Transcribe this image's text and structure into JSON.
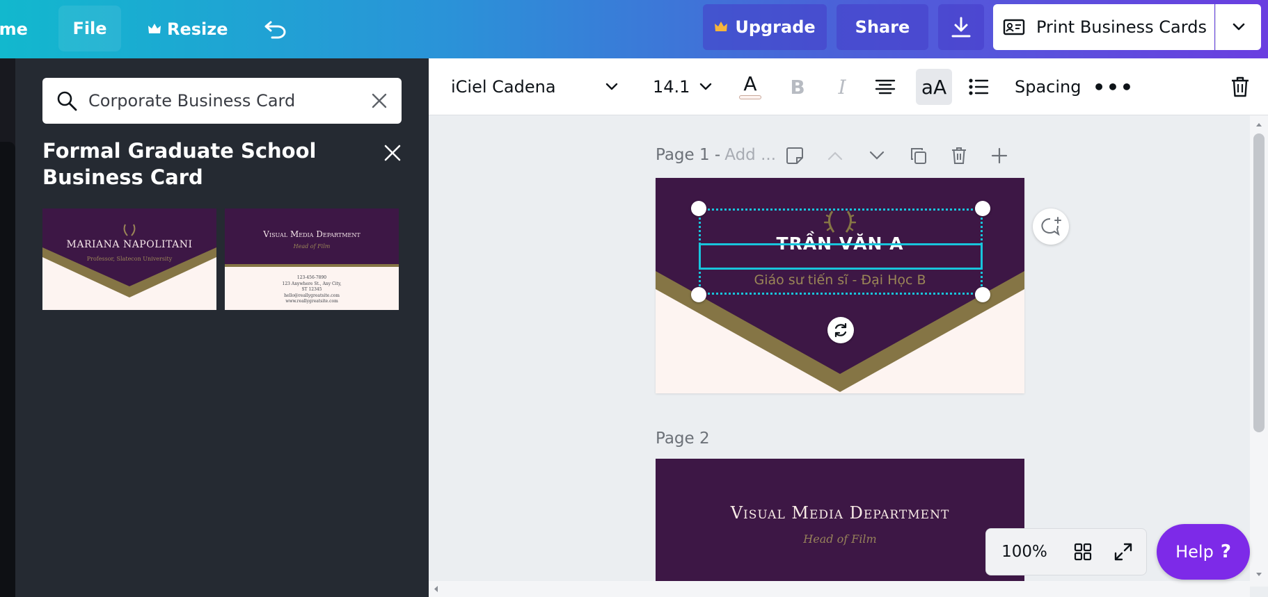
{
  "topbar": {
    "home_label": "Home",
    "file_label": "File",
    "resize_label": "Resize",
    "upgrade_label": "Upgrade",
    "share_label": "Share",
    "print_label": "Print Business Cards"
  },
  "format_toolbar": {
    "font_name": "iCiel Cadena",
    "font_size": "14.1",
    "color_glyph": "A",
    "bold_glyph": "B",
    "italic_glyph": "I",
    "case_glyph": "aA",
    "spacing_label": "Spacing",
    "more_glyph": "•••"
  },
  "panel": {
    "search_value": "Corporate Business Card",
    "title": "Formal Graduate School Business Card",
    "thumbnails": [
      {
        "name": "MARIANA NAPOLITANI",
        "subtitle": "Professor, Slatecon University"
      },
      {
        "name": "Visual Media Department",
        "subtitle": "Head of Film",
        "contact": [
          "123-456-7890",
          "123 Anywhere St., Any City,",
          "ST 12345",
          "hello@reallygreatsite.com",
          "www.reallygreatsite.com"
        ]
      }
    ]
  },
  "canvas": {
    "page1_label": "Page 1 -",
    "page1_add": "Add ...",
    "page2_label": "Page 2",
    "card_name": "TRẦN VĂN A",
    "card_subtitle": "Giáo sư tiến sĩ - Đại Học B",
    "page2_title": "Visual Media Department",
    "page2_subtitle": "Head of Film"
  },
  "bottom": {
    "zoom": "100%",
    "help_label": "Help"
  },
  "colors": {
    "accent_purple": "#7d2ae8",
    "card_purple": "#3d1745",
    "card_gold": "#857545",
    "card_cream": "#fdf4f1",
    "selection_cyan": "#18c5dc"
  }
}
